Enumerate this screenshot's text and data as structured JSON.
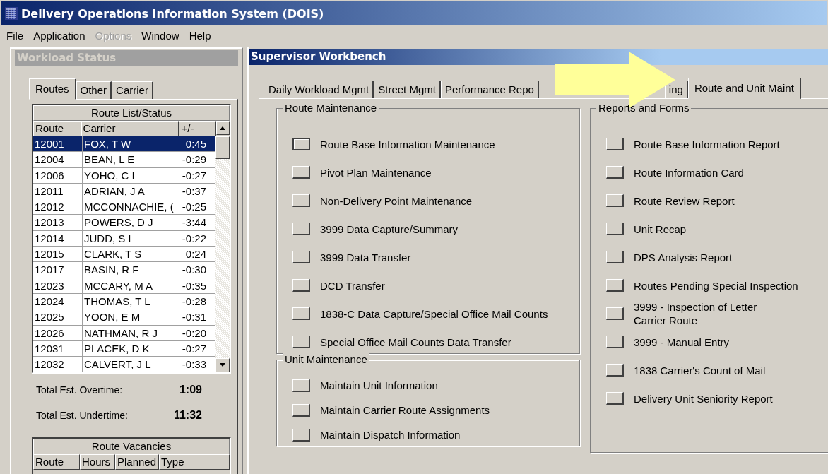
{
  "window": {
    "title": "Delivery Operations Information System (DOIS)"
  },
  "menu": [
    {
      "label": "File",
      "disabled": false
    },
    {
      "label": "Application",
      "disabled": false
    },
    {
      "label": "Options",
      "disabled": true
    },
    {
      "label": "Window",
      "disabled": false
    },
    {
      "label": "Help",
      "disabled": false
    }
  ],
  "workload_status": {
    "title": "Workload Status",
    "tabs": [
      {
        "label": "Routes",
        "selected": true
      },
      {
        "label": "Other",
        "selected": false
      },
      {
        "label": "Carrier",
        "selected": false
      }
    ],
    "route_list": {
      "title": "Route List/Status",
      "columns": [
        "Route",
        "Carrier",
        "+/-"
      ],
      "rows": [
        {
          "route": "12001",
          "carrier": "FOX, T W",
          "diff": "0:45",
          "selected": true
        },
        {
          "route": "12004",
          "carrier": "BEAN, L E",
          "diff": "-0:29",
          "selected": false
        },
        {
          "route": "12006",
          "carrier": "YOHO, C I",
          "diff": "-0:27",
          "selected": false
        },
        {
          "route": "12011",
          "carrier": "ADRIAN, J A",
          "diff": "-0:37",
          "selected": false
        },
        {
          "route": "12012",
          "carrier": "MCCONNACHIE, (",
          "diff": "-0:25",
          "selected": false
        },
        {
          "route": "12013",
          "carrier": "POWERS, D J",
          "diff": "-3:44",
          "selected": false
        },
        {
          "route": "12014",
          "carrier": "JUDD, S L",
          "diff": "-0:22",
          "selected": false
        },
        {
          "route": "12015",
          "carrier": "CLARK, T S",
          "diff": "0:24",
          "selected": false
        },
        {
          "route": "12017",
          "carrier": "BASIN, R F",
          "diff": "-0:30",
          "selected": false
        },
        {
          "route": "12023",
          "carrier": "MCCARY, M A",
          "diff": "-0:35",
          "selected": false
        },
        {
          "route": "12024",
          "carrier": "THOMAS, T L",
          "diff": "-0:28",
          "selected": false
        },
        {
          "route": "12025",
          "carrier": "YOON, E M",
          "diff": "-0:31",
          "selected": false
        },
        {
          "route": "12026",
          "carrier": "NATHMAN, R J",
          "diff": "-0:20",
          "selected": false
        },
        {
          "route": "12031",
          "carrier": "PLACEK, D K",
          "diff": "-0:27",
          "selected": false
        },
        {
          "route": "12032",
          "carrier": "CALVERT, J L",
          "diff": "-0:33",
          "selected": false
        }
      ]
    },
    "totals": [
      {
        "label": "Total Est. Overtime:",
        "value": "1:09"
      },
      {
        "label": "Total Est. Undertime:",
        "value": "11:32"
      }
    ],
    "vacancies": {
      "title": "Route Vacancies",
      "columns": [
        "Route",
        "Hours",
        "Planned",
        "Type"
      ]
    }
  },
  "workbench": {
    "title": "Supervisor Workbench",
    "tabs": [
      {
        "label": "Daily Workload Mgmt",
        "selected": false
      },
      {
        "label": "Street Mgmt",
        "selected": false
      },
      {
        "label": "Performance Repo",
        "selected": false
      },
      {
        "label": "ing",
        "selected": false
      },
      {
        "label": "Route and Unit Maint",
        "selected": true
      }
    ],
    "route_maintenance": {
      "title": "Route Maintenance",
      "items": [
        "Route Base Information Maintenance",
        "Pivot Plan Maintenance",
        "Non-Delivery Point Maintenance",
        "3999 Data Capture/Summary",
        "3999 Data Transfer",
        "DCD Transfer",
        "1838-C Data Capture/Special Office Mail Counts",
        "Special Office Mail Counts Data Transfer"
      ]
    },
    "unit_maintenance": {
      "title": "Unit Maintenance",
      "items": [
        "Maintain Unit Information",
        "Maintain Carrier Route Assignments",
        "Maintain Dispatch Information"
      ]
    },
    "reports_and_forms": {
      "title": "Reports and Forms",
      "items": [
        "Route Base Information Report",
        "Route Information Card",
        "Route Review Report",
        "Unit Recap",
        "DPS Analysis Report",
        "Routes Pending Special Inspection",
        "3999 - Inspection of Letter\nCarrier Route",
        "3999 - Manual Entry",
        "1838 Carrier's Count of Mail",
        "Delivery Unit Seniority Report"
      ]
    }
  }
}
